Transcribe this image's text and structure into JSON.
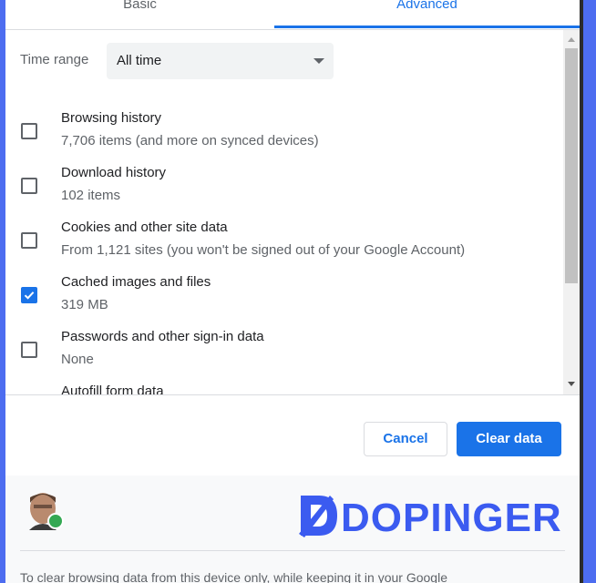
{
  "tabs": [
    {
      "label": "Basic",
      "active": false
    },
    {
      "label": "Advanced",
      "active": true
    }
  ],
  "time_range": {
    "label": "Time range",
    "value": "All time"
  },
  "items": [
    {
      "title": "Browsing history",
      "subtitle": "7,706 items (and more on synced devices)",
      "checked": false
    },
    {
      "title": "Download history",
      "subtitle": "102 items",
      "checked": false
    },
    {
      "title": "Cookies and other site data",
      "subtitle": "From 1,121 sites (you won't be signed out of your Google Account)",
      "checked": false
    },
    {
      "title": "Cached images and files",
      "subtitle": "319 MB",
      "checked": true
    },
    {
      "title": "Passwords and other sign-in data",
      "subtitle": "None",
      "checked": false
    },
    {
      "title": "Autofill form data",
      "subtitle": "",
      "checked": false
    }
  ],
  "buttons": {
    "cancel": "Cancel",
    "clear": "Clear data"
  },
  "footer": {
    "brand": "DOPINGER",
    "note": "To clear browsing data from this device only, while keeping it in your Google"
  },
  "colors": {
    "accent": "#1a73e8",
    "brand": "#3b5bf0",
    "frame": "#4d6df0"
  }
}
